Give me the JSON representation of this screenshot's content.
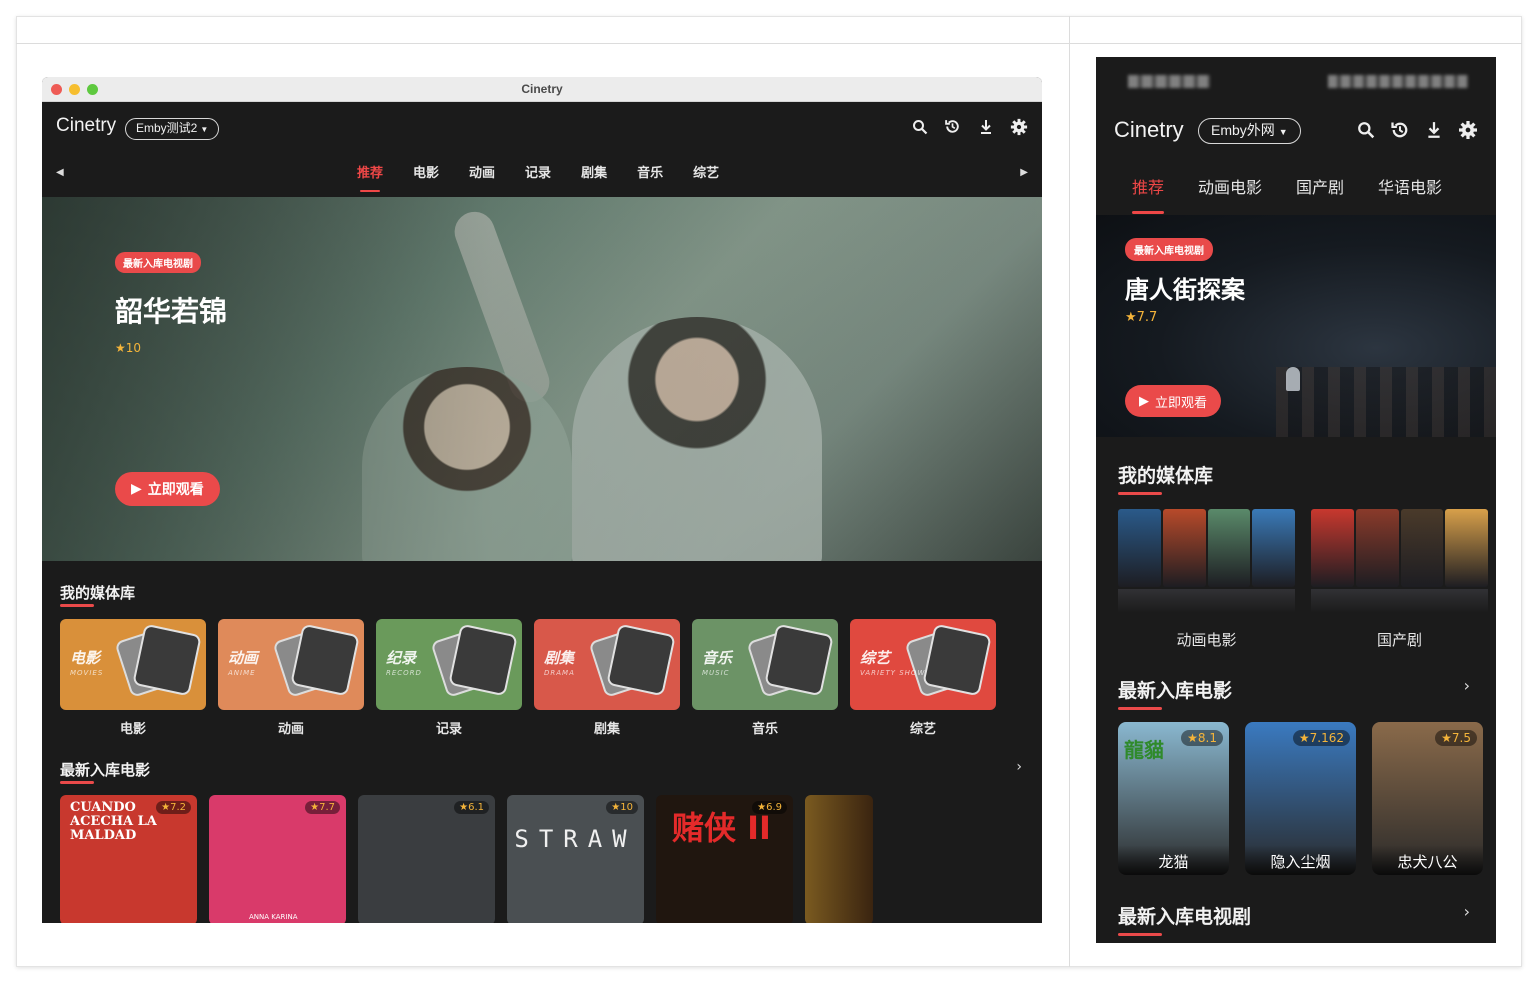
{
  "desktop": {
    "window_title": "Cinetry",
    "brand": "Cinetry",
    "server": "Emby测试2",
    "tabs": [
      "推荐",
      "电影",
      "动画",
      "记录",
      "剧集",
      "音乐",
      "综艺"
    ],
    "active_tab": "推荐",
    "hero": {
      "badge": "最新入库电视剧",
      "title": "韶华若锦",
      "rating": "★10",
      "play_label": "立即观看"
    },
    "library_heading": "我的媒体库",
    "libraries": [
      {
        "label": "电影",
        "art_zh": "电影",
        "art_en": "MOVIES",
        "color": "#d9903a"
      },
      {
        "label": "动画",
        "art_zh": "动画",
        "art_en": "ANIME",
        "color": "#df8a5a"
      },
      {
        "label": "记录",
        "art_zh": "纪录",
        "art_en": "RECORD",
        "color": "#6a9a5b"
      },
      {
        "label": "剧集",
        "art_zh": "剧集",
        "art_en": "DRAMA",
        "color": "#d8584a"
      },
      {
        "label": "音乐",
        "art_zh": "音乐",
        "art_en": "MUSIC",
        "color": "#6c9366"
      },
      {
        "label": "综艺",
        "art_zh": "综艺",
        "art_en": "VARIETY SHOW",
        "color": "#e0493f"
      }
    ],
    "movies_heading": "最新入库电影",
    "movies": [
      {
        "rating": "★7.2",
        "art_text": "CUANDO ACECHA LA MALDAD",
        "color": "#c8382e"
      },
      {
        "rating": "★7.7",
        "art_text": "ANNA KARINA",
        "color": "#d93a6a"
      },
      {
        "rating": "★6.1",
        "art_text": "",
        "color": "#3a3d40"
      },
      {
        "rating": "★10",
        "art_text": "STRAW",
        "color": "#4a4f52"
      },
      {
        "rating": "★6.9",
        "art_text": "赌侠 II",
        "color": "#20160f"
      },
      {
        "rating": "",
        "art_text": "",
        "color": "#6b7a4a"
      }
    ]
  },
  "mobile": {
    "brand": "Cinetry",
    "server": "Emby外网",
    "tabs": [
      "推荐",
      "动画电影",
      "国产剧",
      "华语电影"
    ],
    "active_tab": "推荐",
    "hero": {
      "badge": "最新入库电视剧",
      "title": "唐人街探案",
      "rating": "★7.7",
      "play_label": "立即观看"
    },
    "library_heading": "我的媒体库",
    "libraries": [
      {
        "label": "动画电影",
        "colors": [
          "#2a5a8a",
          "#b84a2a",
          "#5a8a6a",
          "#3a7ab8"
        ]
      },
      {
        "label": "国产剧",
        "colors": [
          "#c8382e",
          "#8a3a2a",
          "#4a3a2a",
          "#d8a04a"
        ]
      }
    ],
    "movies_heading": "最新入库电影",
    "movies": [
      {
        "name": "龙猫",
        "rating": "★8.1",
        "art_text": "龍貓",
        "color": "#8ab8d0"
      },
      {
        "name": "隐入尘烟",
        "rating": "★7.162",
        "color": "#3a7ac0"
      },
      {
        "name": "忠犬八公",
        "rating": "★7.5",
        "color": "#8a6a4a"
      }
    ],
    "tv_heading": "最新入库电视剧"
  }
}
